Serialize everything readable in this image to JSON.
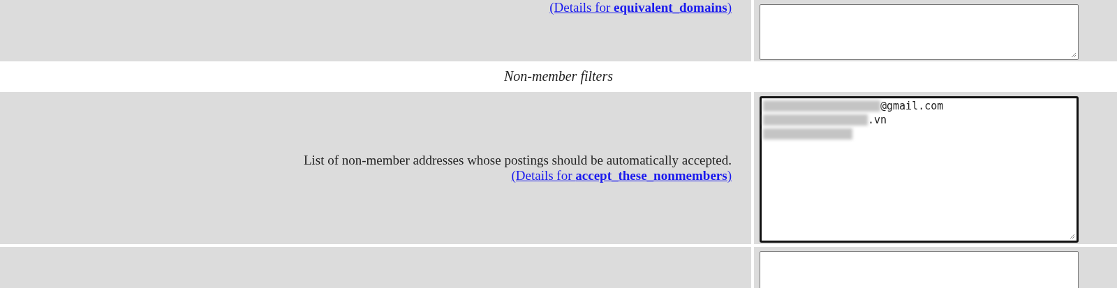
{
  "rows": [
    {
      "kind": "setting",
      "link": {
        "prefix": "(Details for ",
        "name": "equivalent_domains",
        "suffix": ")"
      },
      "field": {}
    },
    {
      "kind": "section",
      "title": "Non-member filters"
    },
    {
      "kind": "setting",
      "description": "List of non-member addresses whose postings should be automatically accepted.",
      "link": {
        "prefix": "(Details for ",
        "name": "accept_these_nonmembers",
        "suffix": ")"
      },
      "field": {
        "focused": true,
        "lines": [
          {
            "redacted": true,
            "text": "@gmail.com"
          },
          {
            "redacted": true,
            "text": ".vn"
          },
          {
            "redacted": true
          }
        ]
      }
    },
    {
      "kind": "setting",
      "field": {}
    }
  ]
}
